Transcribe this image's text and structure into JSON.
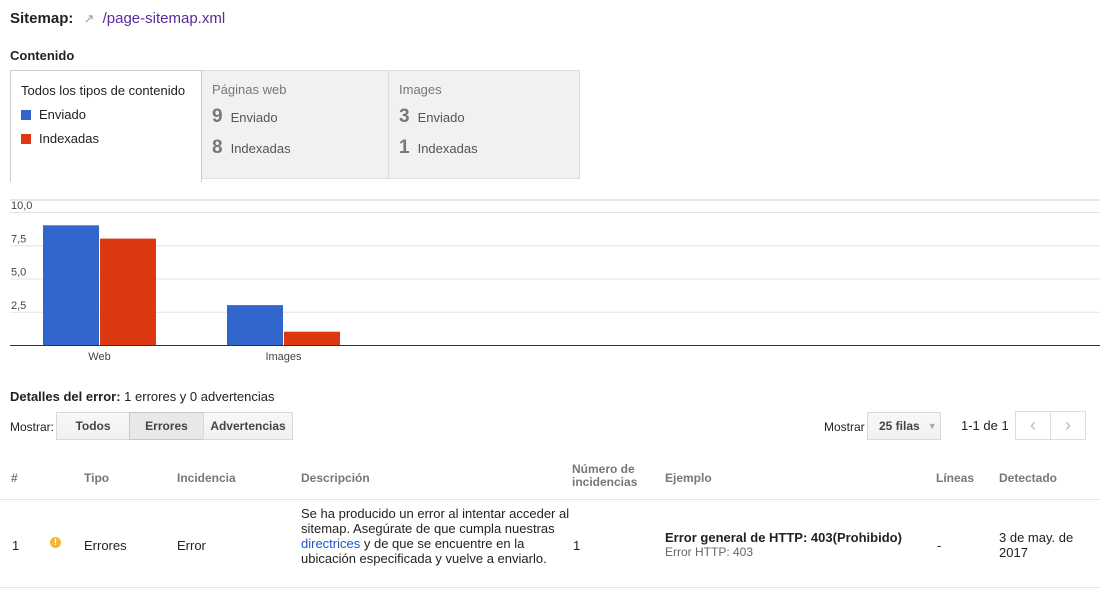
{
  "header": {
    "label": "Sitemap:",
    "path": "/page-sitemap.xml",
    "link_icon": "external-link-icon"
  },
  "content": {
    "heading": "Contenido",
    "tabs": [
      {
        "title": "Todos los tipos de contenido",
        "legend_submitted": "Enviado",
        "legend_indexed": "Indexadas"
      },
      {
        "title": "Páginas web",
        "submitted_count": "9",
        "submitted_label": "Enviado",
        "indexed_count": "8",
        "indexed_label": "Indexadas"
      },
      {
        "title": "Images",
        "submitted_count": "3",
        "submitted_label": "Enviado",
        "indexed_count": "1",
        "indexed_label": "Indexadas"
      }
    ],
    "colors": {
      "submitted": "#3366cc",
      "indexed": "#dc3912"
    }
  },
  "chart_data": {
    "type": "bar",
    "categories": [
      "Web",
      "Images"
    ],
    "series": [
      {
        "name": "Enviado",
        "values": [
          9,
          3
        ]
      },
      {
        "name": "Indexadas",
        "values": [
          8,
          1
        ]
      }
    ],
    "ylim": [
      0,
      10
    ],
    "yticks": [
      "10,0",
      "7,5",
      "5,0",
      "2,5"
    ],
    "ytick_values": [
      10,
      7.5,
      5,
      2.5
    ],
    "grid": true
  },
  "errors": {
    "heading_bold": "Detalles del error:",
    "heading_rest": "1 errores y 0 advertencias",
    "show_label": "Mostrar:",
    "filters": [
      "Todos",
      "Errores",
      "Advertencias"
    ],
    "active_filter": "Errores",
    "rows_label": "Mostrar",
    "rows_value": "25 filas",
    "range": "1-1 de 1",
    "columns": [
      "#",
      "Tipo",
      "Incidencia",
      "Descripción",
      "Número de incidencias",
      "Ejemplo",
      "Líneas",
      "Detectado"
    ],
    "rows": [
      {
        "index": "1",
        "icon": "warning-icon",
        "type": "Errores",
        "issue": "Error",
        "desc_before": "Se ha producido un error al intentar acceder al sitemap. Asegúrate de que cumpla nuestras ",
        "desc_link": "directrices",
        "desc_after": " y de que se encuentre en la ubicación especificada y vuelve a enviarlo.",
        "count": "1",
        "example_title": "Error general de HTTP: 403(Prohibido)",
        "example_detail": "Error HTTP: 403",
        "lines": "-",
        "detected": "3 de may. de 2017"
      }
    ]
  }
}
